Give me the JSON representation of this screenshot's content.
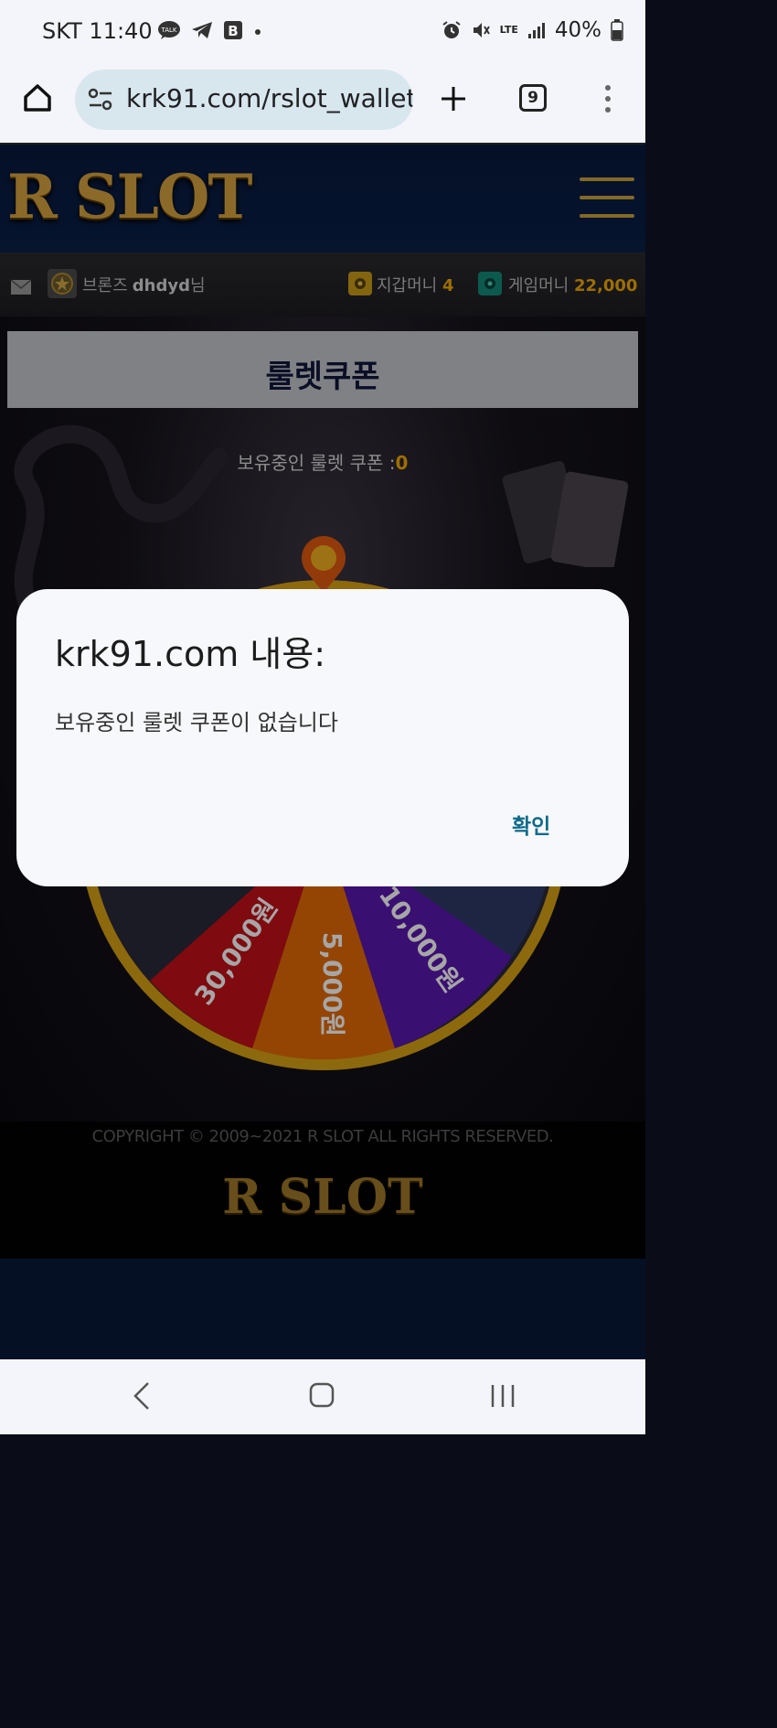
{
  "status_bar": {
    "carrier": "SKT",
    "time": "11:40",
    "battery": "40%",
    "network": "LTE",
    "icons": [
      "talk-icon",
      "telegram-icon",
      "b-app-icon",
      "dot-icon",
      "alarm-icon",
      "mute-icon",
      "lte-icon",
      "signal-icon",
      "battery-icon"
    ]
  },
  "browser": {
    "url": "krk91.com/rslot_wallet",
    "tab_count": "9",
    "icons": [
      "home-icon",
      "site-info-icon",
      "new-tab-icon",
      "tabs-icon",
      "more-menu-icon"
    ]
  },
  "site": {
    "logo": "R SLOT",
    "user": {
      "rank": "브론즈",
      "name": "dhdyd",
      "suffix": "님",
      "wallet_label": "지갑머니",
      "wallet_value": "4",
      "game_label": "게임머니",
      "game_value": "22,000"
    },
    "page_title": "룰렛쿠폰",
    "coupon_label": "보유중인 룰렛 쿠폰 :",
    "coupon_count": "0",
    "wheel_segments": [
      "30,000원",
      "5,000원",
      "10,000원"
    ],
    "copyright": "COPYRIGHT © 2009~2021 R SLOT ALL RIGHTS RESERVED.",
    "footer_logo": "R SLOT"
  },
  "dialog": {
    "title": "krk91.com 내용:",
    "message": "보유중인 룰렛 쿠폰이 없습니다",
    "ok_label": "확인"
  },
  "colors": {
    "gold": "#f2a900",
    "navy": "#0a1f48",
    "dialog_button": "#0f6b8a",
    "wheel_red": "#c41018",
    "wheel_orange": "#e46a06",
    "wheel_purple": "#5a18b0",
    "wheel_rim": "#e8b018"
  }
}
